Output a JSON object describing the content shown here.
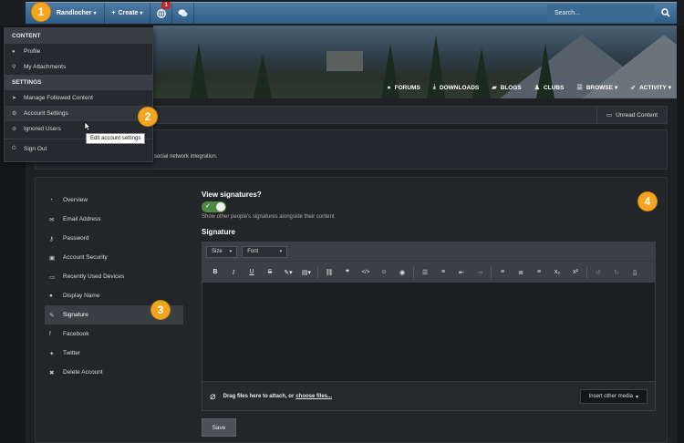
{
  "topbar": {
    "user_label": "Randlocher",
    "create_label": "Create",
    "notification_count": "1",
    "search_placeholder": "Search..."
  },
  "nav": {
    "items": [
      {
        "label": "FORUMS",
        "icon": "chat-bubbles-icon"
      },
      {
        "label": "DOWNLOADS",
        "icon": "download-icon"
      },
      {
        "label": "BLOGS",
        "icon": "speech-bubble-icon"
      },
      {
        "label": "CLUBS",
        "icon": "group-icon"
      },
      {
        "label": "BROWSE",
        "icon": "list-icon"
      },
      {
        "label": "ACTIVITY",
        "icon": "activity-icon"
      }
    ]
  },
  "user_menu": {
    "content_heading": "CONTENT",
    "profile": "Profile",
    "attachments": "My Attachments",
    "settings_heading": "SETTINGS",
    "followed": "Manage Followed Content",
    "account_settings": "Account Settings",
    "ignored": "Ignored Users",
    "sign_out": "Sign Out",
    "tooltip": "Edit account settings"
  },
  "subbar": {
    "unread_label": "Unread Content"
  },
  "info": {
    "text": "social network integration."
  },
  "sidebar": {
    "items": [
      {
        "label": "Overview"
      },
      {
        "label": "Email Address"
      },
      {
        "label": "Password"
      },
      {
        "label": "Account Security"
      },
      {
        "label": "Recently Used Devices"
      },
      {
        "label": "Display Name"
      },
      {
        "label": "Signature"
      },
      {
        "label": "Facebook"
      },
      {
        "label": "Twitter"
      },
      {
        "label": "Delete Account"
      }
    ]
  },
  "content": {
    "view_signatures_title": "View signatures?",
    "view_signatures_desc": "Show other people's signatures alongside their content",
    "signature_title": "Signature",
    "size_label": "Size",
    "font_label": "Font",
    "attach_text": "Drag files here to attach, or",
    "attach_link": "choose files...",
    "insert_media": "Insert other media",
    "save_label": "Save"
  },
  "callouts": [
    "1",
    "2",
    "3",
    "4"
  ],
  "colors": {
    "accent": "#f3a520",
    "topbar": "#3f6d96",
    "toggle_on": "#4f8a43"
  }
}
